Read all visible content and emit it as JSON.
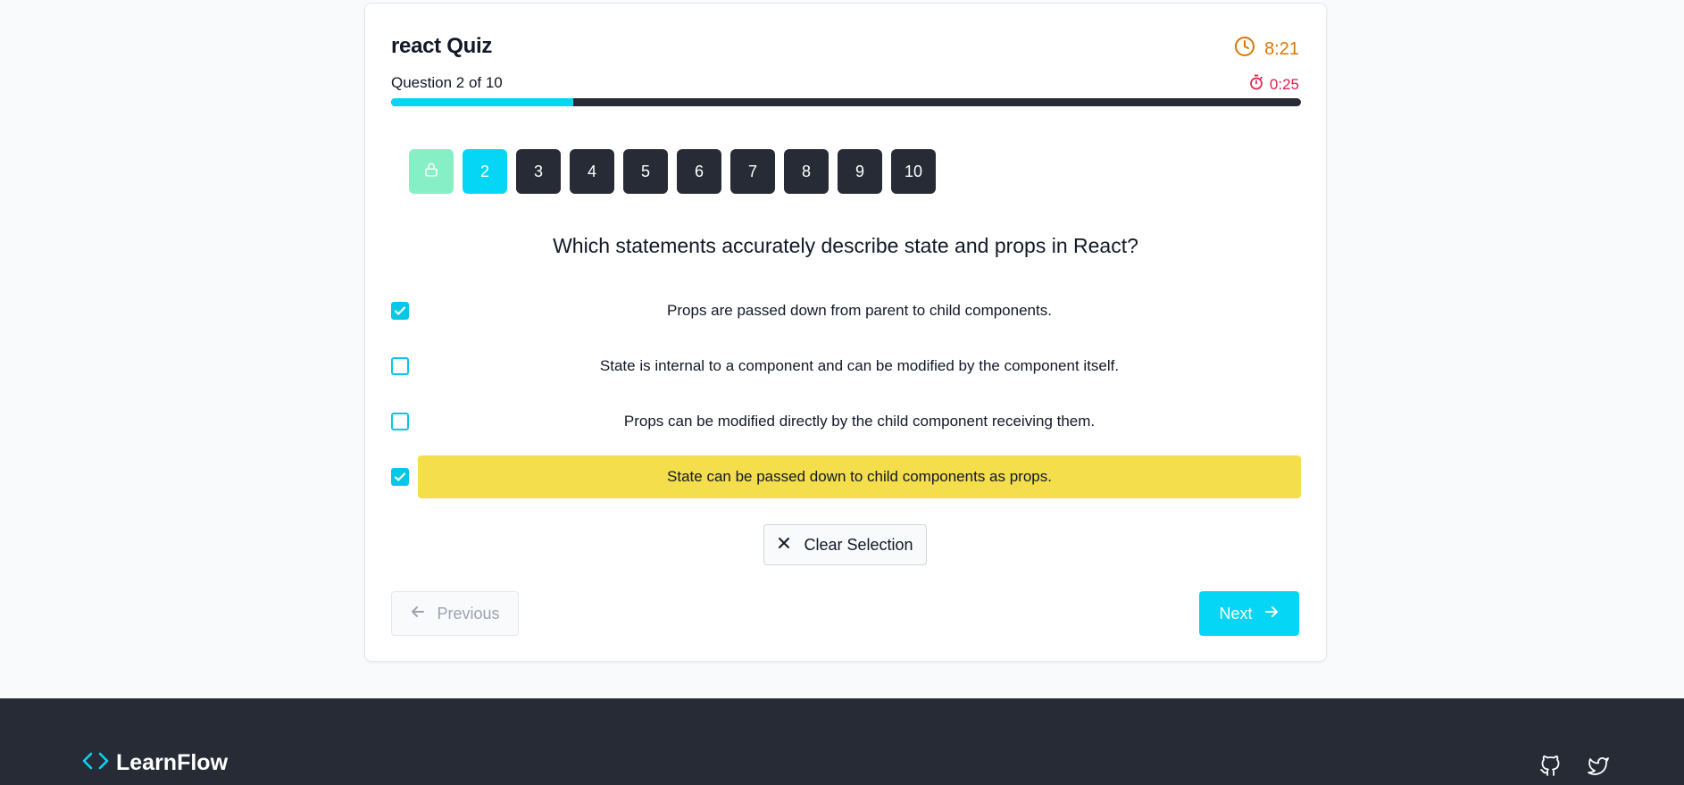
{
  "quiz": {
    "title": "react Quiz",
    "question_counter": "Question 2 of 10",
    "total_time": "8:21",
    "question_time": "0:25",
    "progress_fraction": 0.2,
    "colors": {
      "accent": "#06d6f5",
      "warning": "#d97706",
      "danger": "#e11d48",
      "dark": "#272b36",
      "completed": "#86efc5",
      "highlight": "#f5de4b"
    }
  },
  "question_nav": [
    {
      "label": "",
      "state": "completed",
      "icon": "lock-icon"
    },
    {
      "label": "2",
      "state": "current"
    },
    {
      "label": "3",
      "state": "pending"
    },
    {
      "label": "4",
      "state": "pending"
    },
    {
      "label": "5",
      "state": "pending"
    },
    {
      "label": "6",
      "state": "pending"
    },
    {
      "label": "7",
      "state": "pending"
    },
    {
      "label": "8",
      "state": "pending"
    },
    {
      "label": "9",
      "state": "pending"
    },
    {
      "label": "10",
      "state": "pending"
    }
  ],
  "question": {
    "text": "Which statements accurately describe state and props in React?",
    "options": [
      {
        "text": "Props are passed down from parent to child components.",
        "checked": true,
        "highlighted": false
      },
      {
        "text": "State is internal to a component and can be modified by the component itself.",
        "checked": false,
        "highlighted": false
      },
      {
        "text": "Props can be modified directly by the child component receiving them.",
        "checked": false,
        "highlighted": false
      },
      {
        "text": "State can be passed down to child components as props.",
        "checked": true,
        "highlighted": true
      }
    ]
  },
  "actions": {
    "clear_label": "Clear Selection",
    "previous_label": "Previous",
    "next_label": "Next"
  },
  "footer": {
    "brand": "LearnFlow",
    "social_icons": [
      "github-icon",
      "twitter-icon"
    ]
  }
}
